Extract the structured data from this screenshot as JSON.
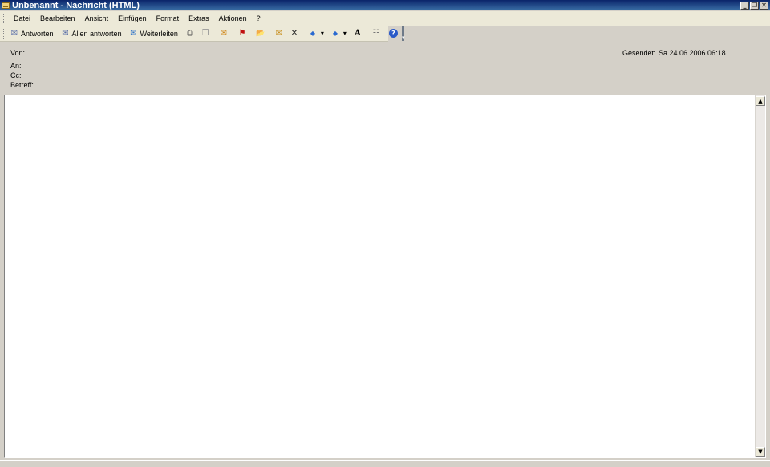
{
  "window": {
    "title": "Unbenannt - Nachricht (HTML)",
    "buttons": {
      "minimize": "_",
      "restore": "❐",
      "close": "✕"
    }
  },
  "menu": {
    "items": [
      {
        "label": "Datei"
      },
      {
        "label": "Bearbeiten"
      },
      {
        "label": "Ansicht"
      },
      {
        "label": "Einfügen"
      },
      {
        "label": "Format"
      },
      {
        "label": "Extras"
      },
      {
        "label": "Aktionen"
      },
      {
        "label": "?"
      }
    ]
  },
  "toolbar": {
    "reply_label": "Antworten",
    "reply_all_label": "Allen antworten",
    "forward_label": "Weiterleiten",
    "icons": {
      "reply": "✉",
      "reply_all": "✉",
      "forward": "✉",
      "print": "⎙",
      "copy": "❐",
      "move": "✉",
      "flag": "⚑",
      "open": "📂",
      "new": "✉",
      "delete": "✕",
      "prev": "◆",
      "prev_drop": "▾",
      "next": "◆",
      "next_drop": "▾",
      "font": "A",
      "address": "☷",
      "help": "?"
    }
  },
  "header": {
    "from_label": "Von:",
    "to_label": "An:",
    "cc_label": "Cc:",
    "subject_label": "Betreff:",
    "sent_label": "Gesendet:",
    "sent_value": "Sa 24.06.2006 06:18"
  },
  "scroll": {
    "up": "▲",
    "down": "▼"
  },
  "colors": {
    "titlebar": "#0a246a",
    "chrome": "#d4d0c8",
    "toolbar": "#ece9d8"
  }
}
